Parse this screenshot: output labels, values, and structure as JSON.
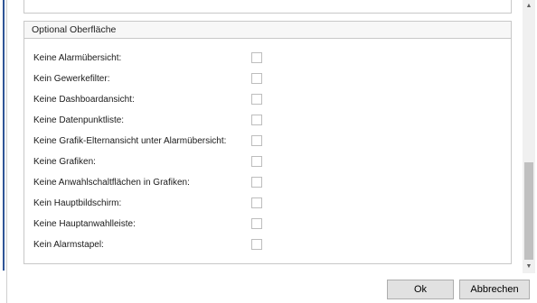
{
  "group": {
    "title": "Optional Oberfläche",
    "items": [
      {
        "label": "Keine Alarmübersicht:",
        "checked": false
      },
      {
        "label": "Kein Gewerkefilter:",
        "checked": false
      },
      {
        "label": "Keine Dashboardansicht:",
        "checked": false
      },
      {
        "label": "Keine Datenpunktliste:",
        "checked": false
      },
      {
        "label": "Keine Grafik-Elternansicht unter Alarmübersicht:",
        "checked": false
      },
      {
        "label": "Keine Grafiken:",
        "checked": false
      },
      {
        "label": "Keine Anwahlschaltflächen in Grafiken:",
        "checked": false
      },
      {
        "label": "Kein Hauptbildschirm:",
        "checked": false
      },
      {
        "label": "Keine Hauptanwahlleiste:",
        "checked": false
      },
      {
        "label": "Kein Alarmstapel:",
        "checked": false
      }
    ]
  },
  "scrollbar": {
    "up_icon": "scroll-up-arrow",
    "down_icon": "scroll-down-arrow"
  },
  "buttons": {
    "ok": "Ok",
    "cancel": "Abbrechen"
  }
}
